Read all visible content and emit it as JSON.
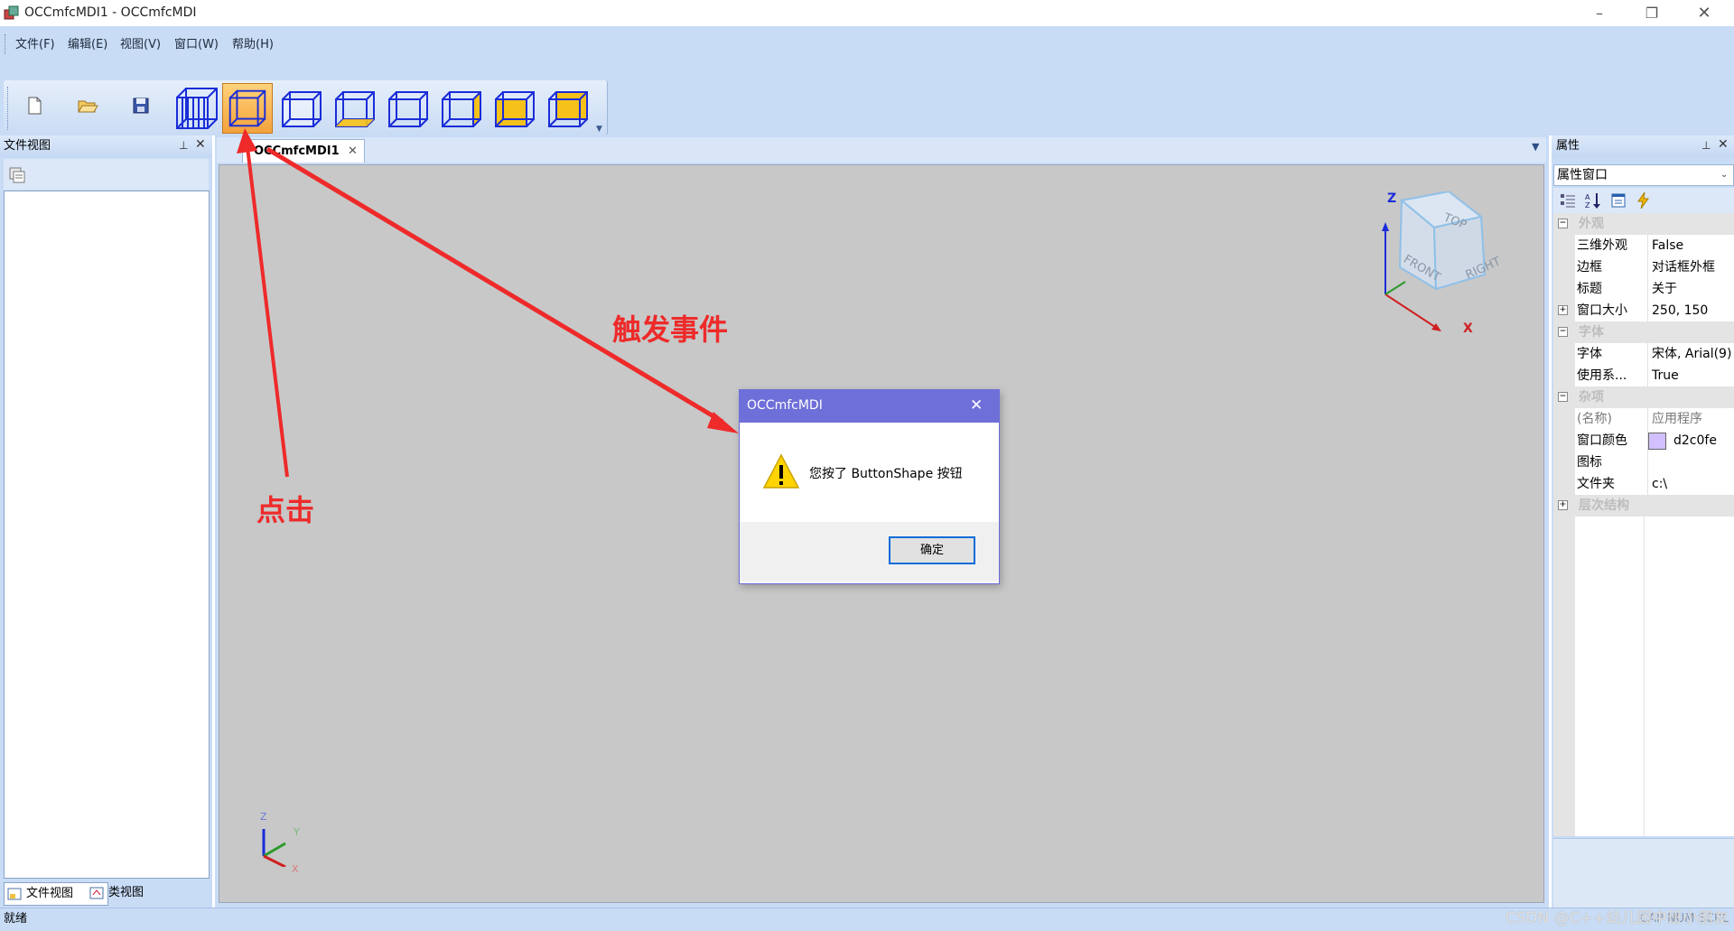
{
  "window": {
    "title": "OCCmfcMDI1 - OCCmfcMDI",
    "controls": [
      "minimize",
      "restore",
      "close"
    ]
  },
  "menu": [
    "文件(F)",
    "编辑(E)",
    "视图(V)",
    "窗口(W)",
    "帮助(H)"
  ],
  "toolbar": {
    "buttons": [
      "new-file-icon",
      "open-folder-icon",
      "save-icon",
      "wireframe-shape-icon",
      "button-shape-icon",
      "front-view-icon",
      "back-view-icon",
      "left-view-icon",
      "right-view-icon",
      "top-view-icon",
      "bottom-view-icon"
    ],
    "active": "button-shape-icon"
  },
  "left_pane": {
    "title": "文件视图",
    "bottom_tabs": [
      "文件视图",
      "类视图"
    ]
  },
  "doc": {
    "tab_label": "OCCmfcMDI1",
    "view_cube": {
      "top": "TOP",
      "front": "FRONT",
      "right": "RIGHT"
    },
    "axes": {
      "z": "Z",
      "x": "X",
      "y": "Y"
    }
  },
  "properties": {
    "title": "属性",
    "combo": "属性窗口",
    "categories": [
      {
        "name": "外观",
        "rows": [
          {
            "name": "三维外观",
            "value": "False"
          },
          {
            "name": "边框",
            "value": "对话框外框"
          },
          {
            "name": "标题",
            "value": "关于"
          },
          {
            "name": "窗口大小",
            "value": "250, 150",
            "expandable": true
          }
        ]
      },
      {
        "name": "字体",
        "rows": [
          {
            "name": "字体",
            "value": "宋体, Arial(9)"
          },
          {
            "name": "使用系...",
            "value": "True"
          }
        ]
      },
      {
        "name": "杂项",
        "rows": [
          {
            "name": "(名称)",
            "value": "应用程序"
          },
          {
            "name": "窗口颜色",
            "value": "d2c0fe",
            "swatch": "#d2c0fe"
          },
          {
            "name": "图标",
            "value": ""
          },
          {
            "name": "文件夹",
            "value": "c:\\"
          }
        ]
      },
      {
        "name": "层次结构",
        "rows": []
      }
    ]
  },
  "status": {
    "left": "就绪",
    "indicators": "CAP NUM SCRL"
  },
  "dialog": {
    "title": "OCCmfcMDI",
    "message": "您按了 ButtonShape 按钮",
    "ok_label": "确定"
  },
  "annotations": {
    "click": "点击",
    "event": "触发事件"
  },
  "watermark": "CSDN @C++幼儿园中班小朋友",
  "colors": {
    "chrome": "#c8dcf6",
    "dialog_title": "#6f6fd9",
    "annotation": "#ee2a2a",
    "active_button": "#f4a23c"
  }
}
